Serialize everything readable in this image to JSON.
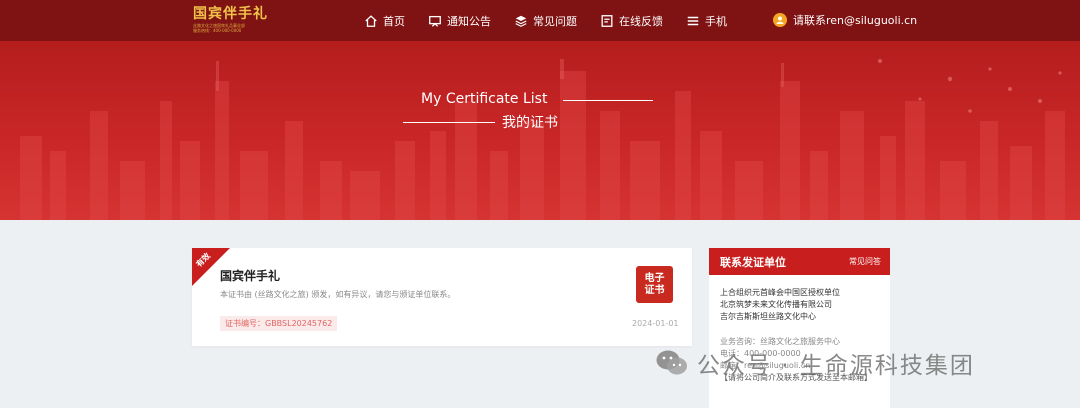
{
  "nav": {
    "logo_text": "国宾伴手礼",
    "logo_sub1": "丝路文化之旅国宾礼品事业部",
    "logo_sub2": "服务热线：400-000-0000",
    "menu": [
      {
        "label": "首页",
        "icon": "home-icon"
      },
      {
        "label": "通知公告",
        "icon": "notice-icon"
      },
      {
        "label": "常见问题",
        "icon": "faq-icon"
      },
      {
        "label": "在线反馈",
        "icon": "feedback-icon"
      },
      {
        "label": "手机",
        "icon": "mobile-icon"
      }
    ],
    "contact_label": "请联系ren@siluguoli.cn",
    "contact_icon": "user-icon"
  },
  "hero": {
    "title_en": "My Certificate List",
    "title_zh": "我的证书"
  },
  "certificate": {
    "status": "有效",
    "title": "国宾伴手礼",
    "description": "本证书由 (丝路文化之旅) 颁发，如有异议，请您与颁证单位联系。",
    "number": "证书编号：GBBSL20245762",
    "date": "2024-01-01",
    "badge_line1": "电子",
    "badge_line2": "证书"
  },
  "sidebar": {
    "title": "联系发证单位",
    "faq_link": "常见问答",
    "orgs": [
      "上合组织元首峰会中国区授权单位",
      "北京筑梦未来文化传播有限公司",
      "吉尔吉斯斯坦丝路文化中心"
    ],
    "info": [
      "业务咨询：丝路文化之旅服务中心",
      "电话：400-000-0000",
      "邮箱：ren@siluguoli.cn"
    ],
    "footer_link": "【请将公司简介及联系方式发送至本邮箱】"
  },
  "watermark": {
    "text": "公众号 · 生命源科技集团",
    "icon": "wechat-icon"
  },
  "colors": {
    "nav_bg": "#7f1212",
    "banner_red": "#c92727",
    "accent_red": "#c81e1e",
    "logo_gold": "#f1c24b",
    "page_bg": "#edf0f3"
  }
}
